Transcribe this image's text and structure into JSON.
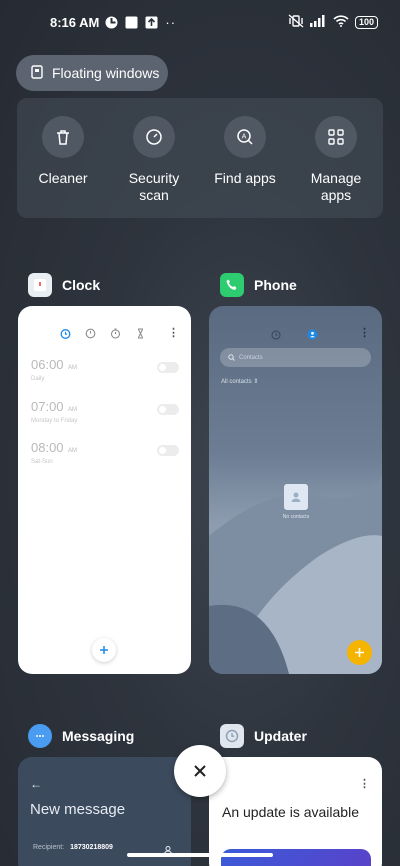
{
  "status_bar": {
    "time": "8:16 AM",
    "battery": "100"
  },
  "floating_windows": {
    "label": "Floating windows"
  },
  "quick_actions": [
    {
      "label": "Cleaner",
      "icon": "trash-icon"
    },
    {
      "label": "Security\nscan",
      "icon": "security-scan-icon"
    },
    {
      "label": "Find apps",
      "icon": "find-apps-icon"
    },
    {
      "label": "Manage\napps",
      "icon": "grid-icon"
    }
  ],
  "apps": {
    "clock": {
      "name": "Clock",
      "alarms": [
        {
          "time": "06:00",
          "ampm": "AM",
          "label": "Daily"
        },
        {
          "time": "07:00",
          "ampm": "AM",
          "label": "Monday to Friday"
        },
        {
          "time": "08:00",
          "ampm": "AM",
          "label": "Sat-Sun"
        }
      ]
    },
    "phone": {
      "name": "Phone",
      "search_placeholder": "Contacts",
      "filter": "All contacts",
      "empty_text": "No contacts"
    },
    "messaging": {
      "name": "Messaging",
      "title": "New message",
      "recipient_label": "Recipient:",
      "recipient_value": "18730218809"
    },
    "updater": {
      "name": "Updater",
      "title": "An update is available"
    }
  },
  "colors": {
    "background": "#2b3139",
    "accent_blue": "#1e88e5",
    "phone_green": "#2ecc71",
    "fab_yellow": "#f5b400"
  }
}
